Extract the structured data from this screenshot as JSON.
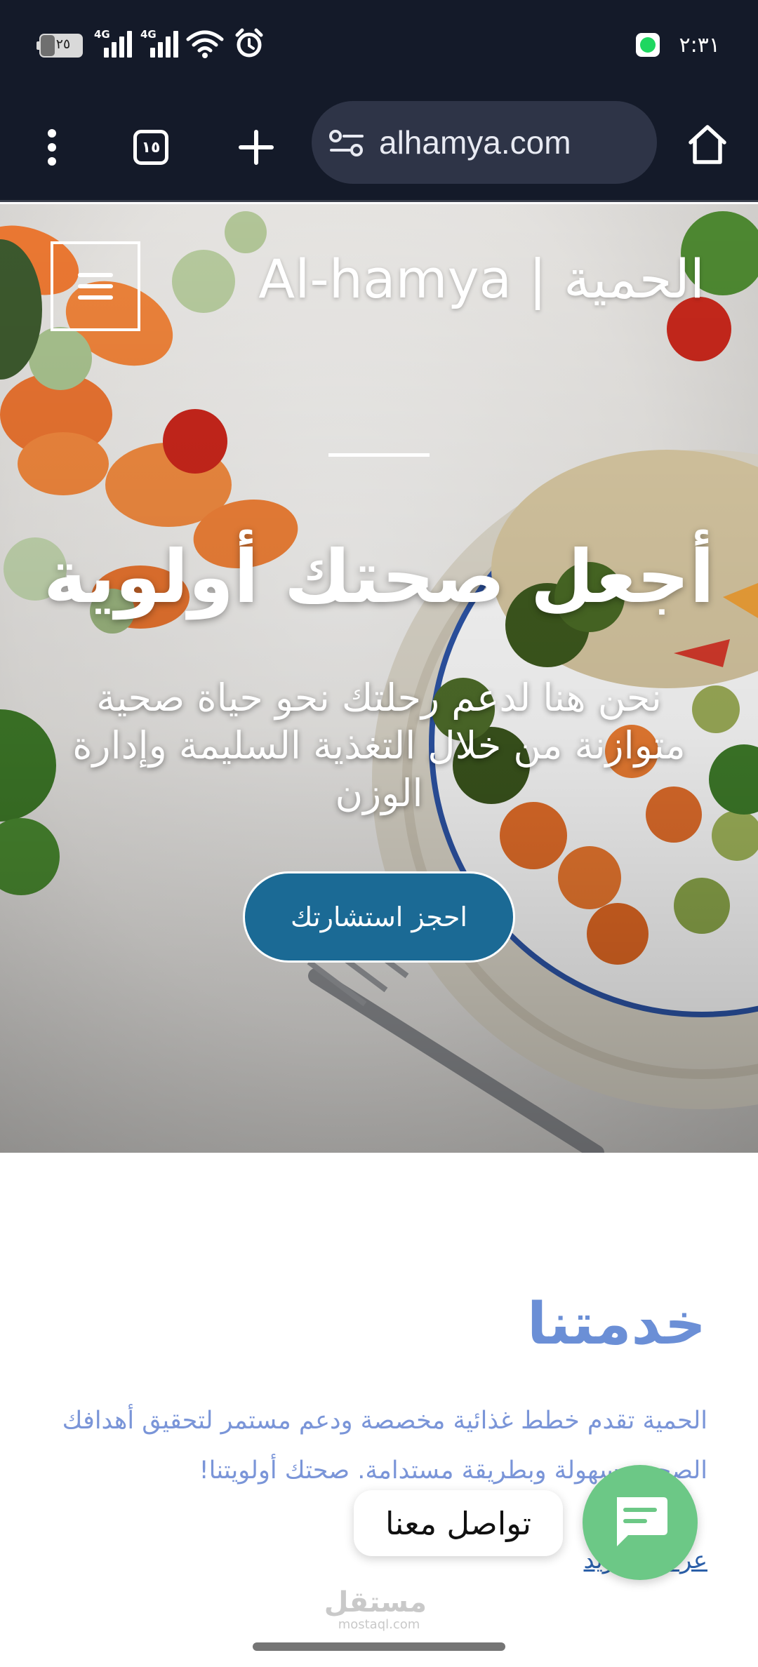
{
  "status_bar": {
    "battery_level": "٢٥",
    "network_1": "4G",
    "network_2": "4G",
    "time": "٢:٣١",
    "icons": [
      "battery-icon",
      "signal-icon",
      "signal-icon",
      "wifi-icon",
      "alarm-icon",
      "spotify-icon"
    ]
  },
  "browser": {
    "url": "alhamya.com",
    "tabs_count": "١٥",
    "icons": [
      "more-vert-icon",
      "tabs-icon",
      "plus-icon",
      "site-settings-icon",
      "home-icon"
    ]
  },
  "header": {
    "site_title": "Al-hamya | الحمية",
    "menu_icon": "hamburger-icon"
  },
  "hero": {
    "heading": "أجعل صحتك أولوية",
    "subtitle": "نحن هنا لدعم رحلتك نحو حياة صحية متوازنة من خلال التغذية السليمة وإدارة الوزن",
    "cta_label": "احجز استشارتك"
  },
  "services": {
    "title": "خدمتنا",
    "description": "الحمية تقدم خطط غذائية مخصصة ودعم مستمر لتحقيق أهدافك الصحية بسهولة وبطريقة مستدامة. صحتك أولويتنا!",
    "link_label": "عرض المزيد"
  },
  "chat_widget": {
    "label": "تواصل معنا",
    "icon": "chat-icon"
  },
  "watermark": {
    "line1": "مستقل",
    "line2": "mostaql.com"
  },
  "colors": {
    "status_bg": "#141a29",
    "url_pill": "#2e3447",
    "cta_bg": "#1b6a95",
    "services_title": "#6b8fd6",
    "services_text": "#7a95d8",
    "chat_green": "#6cc886"
  }
}
